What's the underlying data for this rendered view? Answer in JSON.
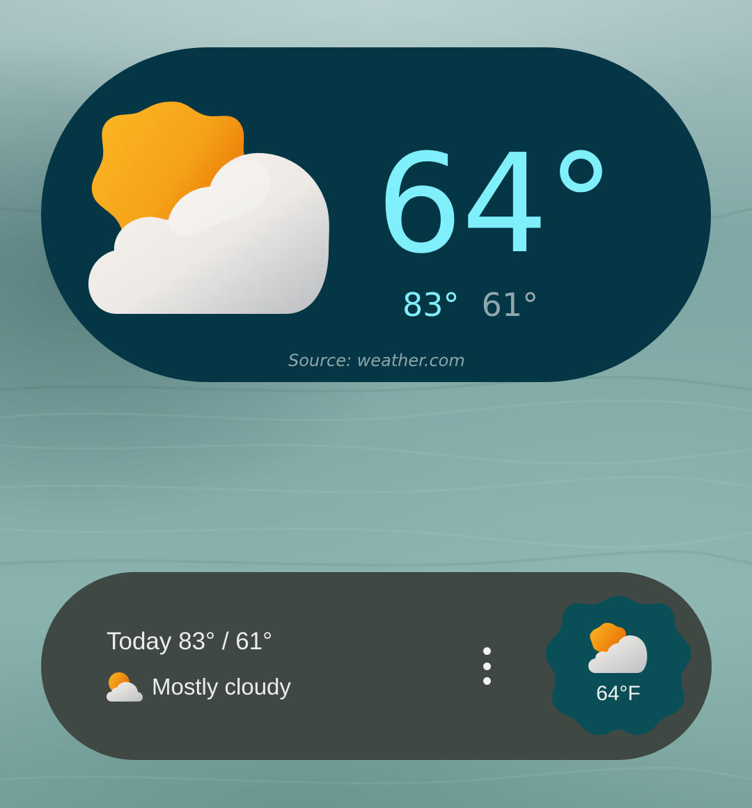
{
  "wallpaper": {
    "description_color_top": "#a9c3c3",
    "description_color_bottom": "#79a29d"
  },
  "weather_widget": {
    "background": "#053646",
    "accent": "#7ff0fb",
    "condition_icon": "partly-cloudy-icon",
    "temperature": "64°",
    "high": "83°",
    "low": "61°",
    "source": "Source: weather.com"
  },
  "glance_widget": {
    "background": "#3f4843",
    "summary": "Today 83° / 61°",
    "condition_icon": "partly-cloudy-icon",
    "condition": "Mostly cloudy",
    "more_icon": "more-vert-icon",
    "badge_color": "#0a4f57",
    "badge_temperature": "64°F"
  }
}
